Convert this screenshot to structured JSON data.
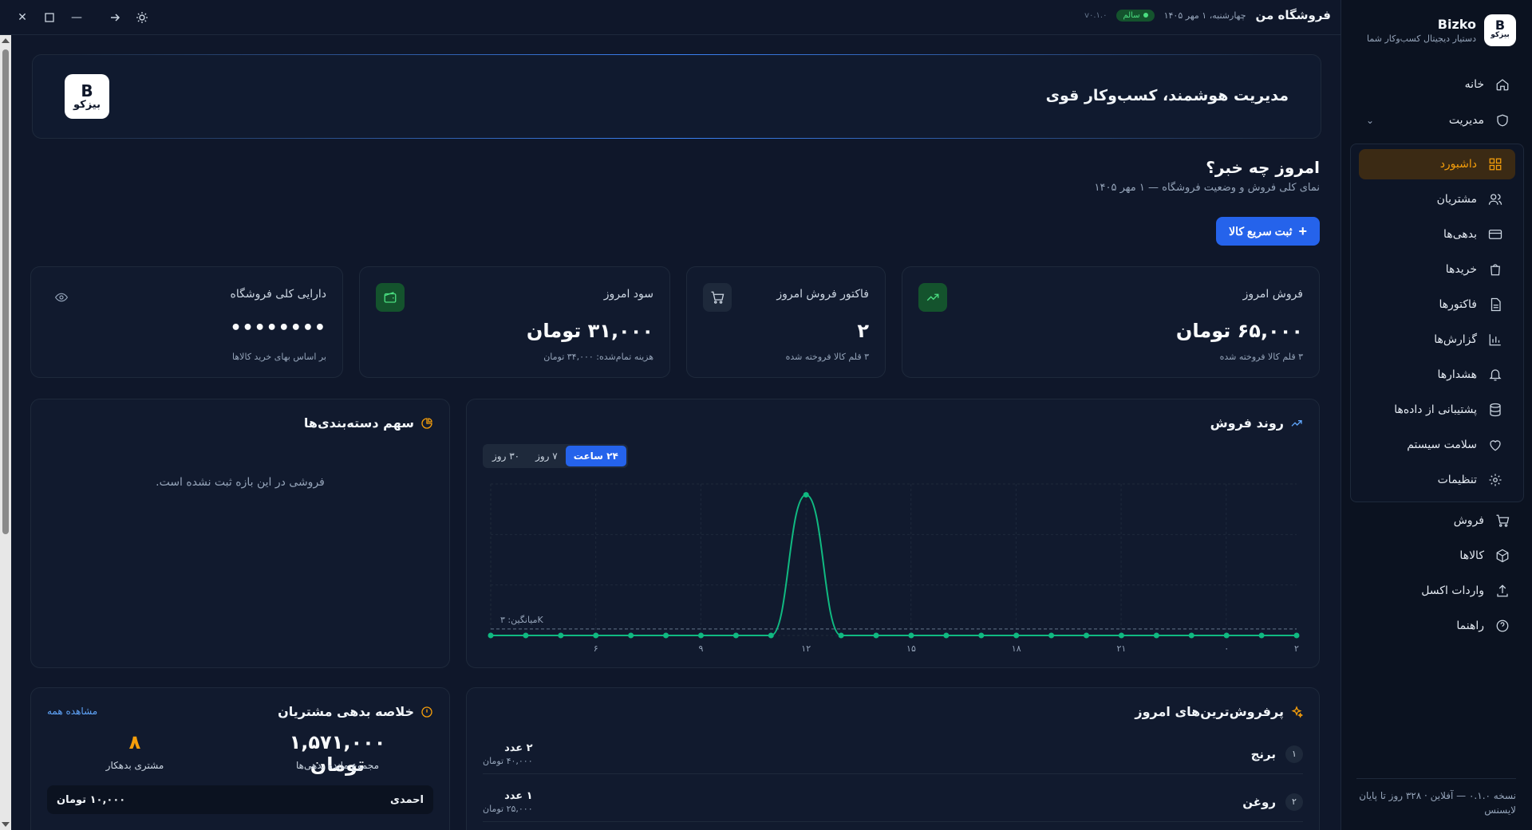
{
  "topbar": {
    "shop_name": "فروشگاه من",
    "date": "چهارشنبه، ۱ مهر ۱۴۰۵",
    "health": "سالم",
    "version": "v۰.۱.۰"
  },
  "sidebar": {
    "brand_name": "Bizko",
    "brand_logo": "بیزکو",
    "brand_tagline": "دستیار دیجیتال کسب‌وکار شما",
    "home": "خانه",
    "management": "مدیریت",
    "sub_items": [
      "داشبورد",
      "مشتریان",
      "بدهی‌ها",
      "خریدها",
      "فاکتورها",
      "گزارش‌ها",
      "هشدارها",
      "پشتیبانی از داده‌ها",
      "سلامت سیستم",
      "تنظیمات"
    ],
    "bottom_items": [
      "فروش",
      "کالاها",
      "واردات اکسل",
      "راهنما"
    ],
    "footer": "نسخه ۰.۱.۰ — آفلاین · ۳۲۸ روز تا پایان لایسنس"
  },
  "hero": {
    "title": "مدیریت هوشمند، کسب‌وکار قوی",
    "logo": "بیزکو"
  },
  "section": {
    "title": "امروز چه خبر؟",
    "subtitle": "نمای کلی فروش و وضعیت فروشگاه — ۱ مهر ۱۴۰۵",
    "quick_add": "ثبت سریع کالا"
  },
  "stats": {
    "sales": {
      "title": "فروش امروز",
      "value": "۶۵,۰۰۰ تومان",
      "note": "۳ قلم کالا فروخته شده"
    },
    "invoices": {
      "title": "فاکتور فروش امروز",
      "value": "۲",
      "note": "۳ قلم کالا فروخته شده"
    },
    "profit": {
      "title": "سود امروز",
      "value": "۳۱,۰۰۰ تومان",
      "note": "هزینه تمام‌شده: ۳۴,۰۰۰ تومان"
    },
    "assets": {
      "title": "دارایی کلی فروشگاه",
      "value": "••••••••",
      "note": "بر اساس بهای خرید کالاها"
    }
  },
  "trend": {
    "title": "روند فروش",
    "tabs": [
      "۲۴ ساعت",
      "۷ روز",
      "۳۰ روز"
    ],
    "avg_label": "میانگین: ۳K"
  },
  "chart_data": {
    "type": "line",
    "x": [
      0,
      1,
      2,
      3,
      4,
      5,
      6,
      7,
      8,
      9,
      10,
      11,
      12,
      13,
      14,
      15,
      16,
      17,
      18,
      19,
      20,
      21,
      22,
      23
    ],
    "x_tick_labels": [
      {
        "x": 3,
        "label": "۶"
      },
      {
        "x": 6,
        "label": "۹"
      },
      {
        "x": 9,
        "label": "۱۲"
      },
      {
        "x": 12,
        "label": "۱۵"
      },
      {
        "x": 15,
        "label": "۱۸"
      },
      {
        "x": 18,
        "label": "۲۱"
      },
      {
        "x": 21,
        "label": "۰"
      },
      {
        "x": 23,
        "label": "۲"
      }
    ],
    "series": [
      {
        "values": [
          0,
          0,
          0,
          0,
          0,
          0,
          0,
          0,
          0,
          65,
          0,
          0,
          0,
          0,
          0,
          0,
          0,
          0,
          0,
          0,
          0,
          0,
          0,
          0
        ]
      }
    ],
    "average": 3,
    "ylim": [
      0,
      70
    ],
    "grid": true,
    "color": "#10b981"
  },
  "categories": {
    "title": "سهم دسته‌بندی‌ها",
    "empty": "فروشی در این بازه ثبت نشده است."
  },
  "top_products": {
    "title": "پرفروش‌ترین‌های امروز",
    "items": [
      {
        "rank": "۱",
        "name": "برنج",
        "qty": "۲ عدد",
        "amount": "۴۰,۰۰۰ تومان"
      },
      {
        "rank": "۲",
        "name": "روغن",
        "qty": "۱ عدد",
        "amount": "۲۵,۰۰۰ تومان"
      }
    ]
  },
  "debts": {
    "title": "خلاصه بدهی مشتریان",
    "see_all": "مشاهده همه",
    "total": "۱,۵۷۱,۰۰۰ تومان",
    "total_label": "مجموع مانده بدهی‌ها",
    "count": "۸",
    "count_label": "مشتری بدهکار",
    "rows": [
      {
        "name": "احمدی",
        "amount": "۱۰,۰۰۰ تومان"
      }
    ]
  }
}
